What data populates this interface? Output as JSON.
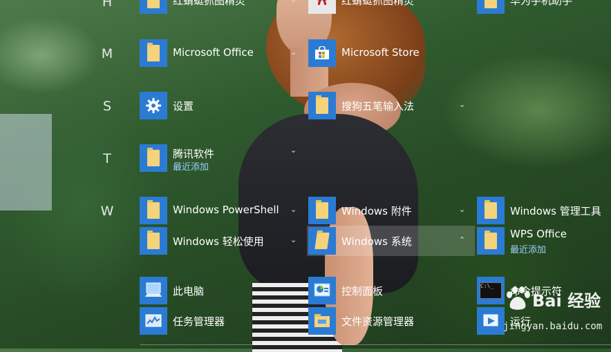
{
  "wallpaper": {
    "accent": "#2b7bd4",
    "link_color": "#9fd0ff"
  },
  "letters": {
    "h": "H",
    "m": "M",
    "s": "S",
    "t": "T",
    "w": "W"
  },
  "apps": {
    "hongqing_tools": {
      "label": "红蜻蜓抓图精灵"
    },
    "hongqing_app": {
      "label": "红蜻蜓抓图精灵"
    },
    "huawei": {
      "label": "华为手机助手"
    },
    "ms_office": {
      "label": "Microsoft Office"
    },
    "ms_store": {
      "label": "Microsoft Store"
    },
    "settings": {
      "label": "设置"
    },
    "sogou": {
      "label": "搜狗五笔输入法"
    },
    "tencent": {
      "label": "腾讯软件",
      "sub": "最近添加"
    },
    "powershell": {
      "label": "Windows PowerShell"
    },
    "accessories": {
      "label": "Windows 附件"
    },
    "admin_tools": {
      "label": "Windows 管理工具"
    },
    "ease_access": {
      "label": "Windows 轻松使用"
    },
    "win_system": {
      "label": "Windows 系统"
    },
    "wps": {
      "label": "WPS Office",
      "sub": "最近添加"
    },
    "this_pc": {
      "label": "此电脑"
    },
    "control_panel": {
      "label": "控制面板"
    },
    "cmd": {
      "label": "命令提示符",
      "icon_text": "C:\\_"
    },
    "task_manager": {
      "label": "任务管理器"
    },
    "file_explorer": {
      "label": "文件资源管理器"
    },
    "run": {
      "label": "运行"
    }
  },
  "icons": {
    "folder": "folder-icon",
    "settings": "gear-icon",
    "store": "store-icon",
    "computer": "computer-icon",
    "control_panel": "control-panel-icon",
    "cmd": "command-prompt-icon",
    "task_manager": "task-manager-icon",
    "file_explorer": "file-explorer-icon",
    "run": "run-icon",
    "expand": "chevron-down-icon",
    "collapse": "chevron-up-icon"
  },
  "watermark": {
    "brand": "Bai 经验",
    "url": "jingyan.baidu.com"
  }
}
